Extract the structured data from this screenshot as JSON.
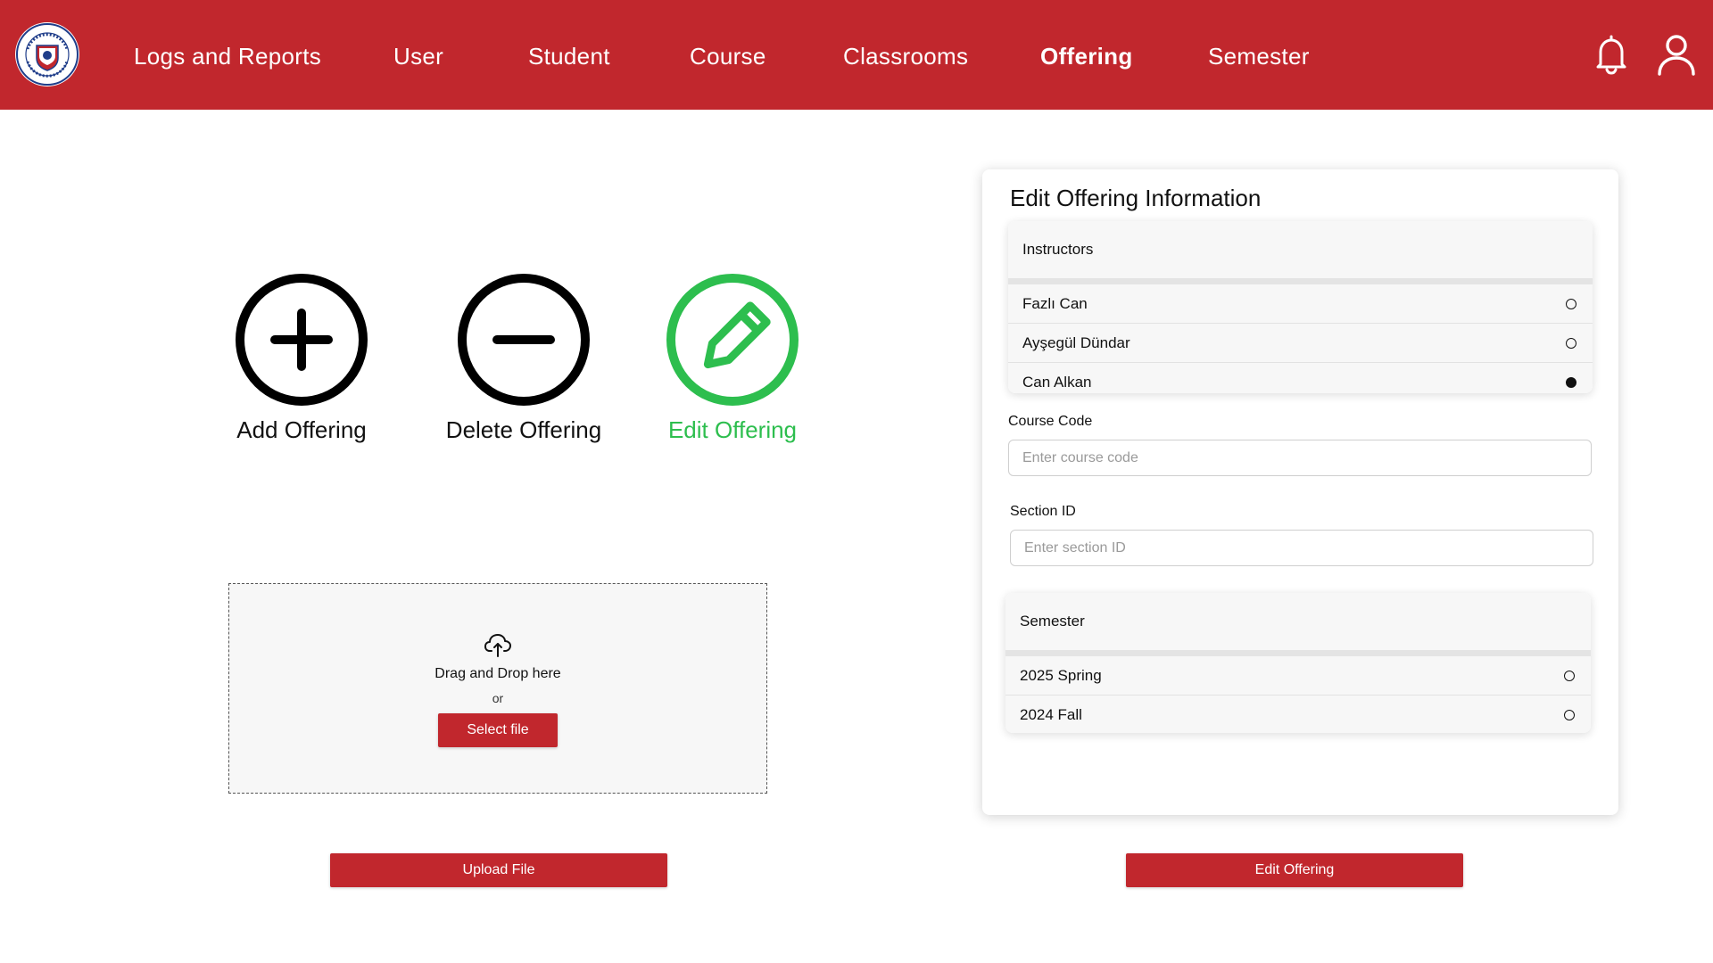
{
  "colors": {
    "brand_red": "#C1272D",
    "active_green": "#2DBE4E"
  },
  "header": {
    "nav": [
      {
        "label": "Logs and Reports"
      },
      {
        "label": "User"
      },
      {
        "label": "Student"
      },
      {
        "label": "Course"
      },
      {
        "label": "Classrooms"
      },
      {
        "label": "Offering",
        "active": true
      },
      {
        "label": "Semester"
      }
    ],
    "icons": [
      "bell-icon",
      "user-icon"
    ]
  },
  "actions": {
    "add": {
      "label": "Add Offering",
      "icon": "plus-circle-icon"
    },
    "delete": {
      "label": "Delete Offering",
      "icon": "minus-circle-icon"
    },
    "edit": {
      "label": "Edit Offering",
      "icon": "edit-circle-icon",
      "active": true
    }
  },
  "upload": {
    "icon": "cloud-upload-icon",
    "drag_text": "Drag and Drop here",
    "or_text": "or",
    "select_label": "Select file",
    "upload_label": "Upload File"
  },
  "form": {
    "title": "Edit Offering Information",
    "instructors": {
      "label": "Instructors",
      "options": [
        {
          "label": "Fazlı Can",
          "selected": false
        },
        {
          "label": "Ayşegül Dündar",
          "selected": false
        },
        {
          "label": "Can Alkan",
          "selected": true
        }
      ]
    },
    "course_code": {
      "label": "Course Code",
      "placeholder": "Enter course code",
      "value": ""
    },
    "section_id": {
      "label": "Section ID",
      "placeholder": "Enter section ID",
      "value": ""
    },
    "semester": {
      "label": "Semester",
      "options": [
        {
          "label": "2025 Spring",
          "selected": false
        },
        {
          "label": "2024 Fall",
          "selected": false
        }
      ]
    },
    "submit_label": "Edit Offering"
  }
}
